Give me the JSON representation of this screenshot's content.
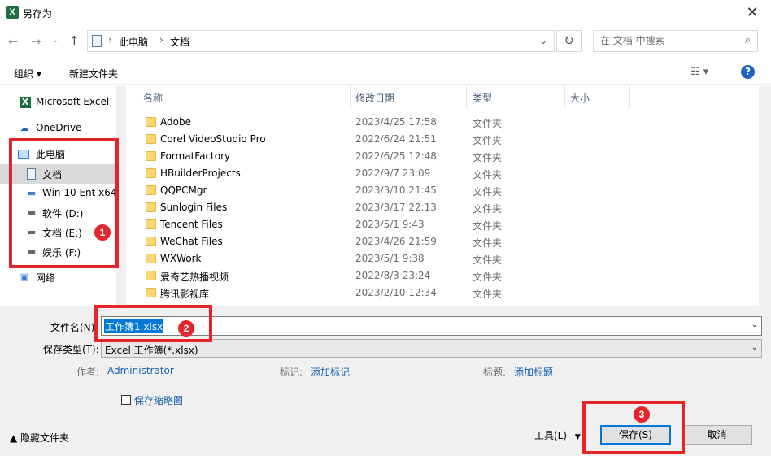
{
  "window": {
    "title": "另存为",
    "app_icon_letter": "X"
  },
  "address": {
    "crumbs": [
      "此电脑",
      "文档"
    ]
  },
  "search": {
    "placeholder": "在 文档 中搜索"
  },
  "toolbar": {
    "organize": "组织 ▾",
    "new_folder": "新建文件夹",
    "help": "?"
  },
  "sidebar": {
    "items": [
      {
        "label": "Microsoft Excel",
        "icon": "excel-icon"
      },
      {
        "label": "OneDrive",
        "icon": "cloud-icon"
      },
      {
        "label": "此电脑",
        "icon": "computer-icon"
      },
      {
        "label": "文档",
        "icon": "document-icon",
        "selected": true
      },
      {
        "label": "Win 10 Ent x64",
        "icon": "network-drive-icon"
      },
      {
        "label": "软件 (D:)",
        "icon": "drive-icon"
      },
      {
        "label": "文档 (E:)",
        "icon": "drive-icon"
      },
      {
        "label": "娱乐 (F:)",
        "icon": "drive-icon"
      },
      {
        "label": "网络",
        "icon": "network-icon"
      }
    ]
  },
  "columns": {
    "name": "名称",
    "date": "修改日期",
    "type": "类型",
    "size": "大小"
  },
  "files": [
    {
      "name": "Adobe",
      "date": "2023/4/25 17:58",
      "type": "文件夹"
    },
    {
      "name": "Corel VideoStudio Pro",
      "date": "2022/6/24 21:51",
      "type": "文件夹"
    },
    {
      "name": "FormatFactory",
      "date": "2022/6/25 12:48",
      "type": "文件夹"
    },
    {
      "name": "HBuilderProjects",
      "date": "2022/9/7 23:09",
      "type": "文件夹"
    },
    {
      "name": "QQPCMgr",
      "date": "2023/3/10 21:45",
      "type": "文件夹"
    },
    {
      "name": "Sunlogin Files",
      "date": "2023/3/17 22:13",
      "type": "文件夹"
    },
    {
      "name": "Tencent Files",
      "date": "2023/5/1 9:43",
      "type": "文件夹"
    },
    {
      "name": "WeChat Files",
      "date": "2023/4/26 21:59",
      "type": "文件夹"
    },
    {
      "name": "WXWork",
      "date": "2023/5/1 9:38",
      "type": "文件夹"
    },
    {
      "name": "爱奇艺热播视频",
      "date": "2022/8/3 23:24",
      "type": "文件夹"
    },
    {
      "name": "腾讯影视库",
      "date": "2023/2/10 12:34",
      "type": "文件夹"
    }
  ],
  "form": {
    "filename_label": "文件名(N):",
    "filename_value": "工作簿1.xlsx",
    "savetype_label": "保存类型(T):",
    "savetype_value": "Excel 工作簿(*.xlsx)",
    "author_label": "作者:",
    "author_value": "Administrator",
    "tags_label": "标记:",
    "tags_value": "添加标记",
    "title_label": "标题:",
    "title_value": "添加标题",
    "thumbnail_label": "保存缩略图"
  },
  "footer": {
    "hide_folders": "▲  隐藏文件夹",
    "tools": "工具(L)",
    "save": "保存(S)",
    "cancel": "取消"
  },
  "annotations": {
    "badge1": "1",
    "badge2": "2",
    "badge3": "3",
    "color": "#e5252a"
  }
}
